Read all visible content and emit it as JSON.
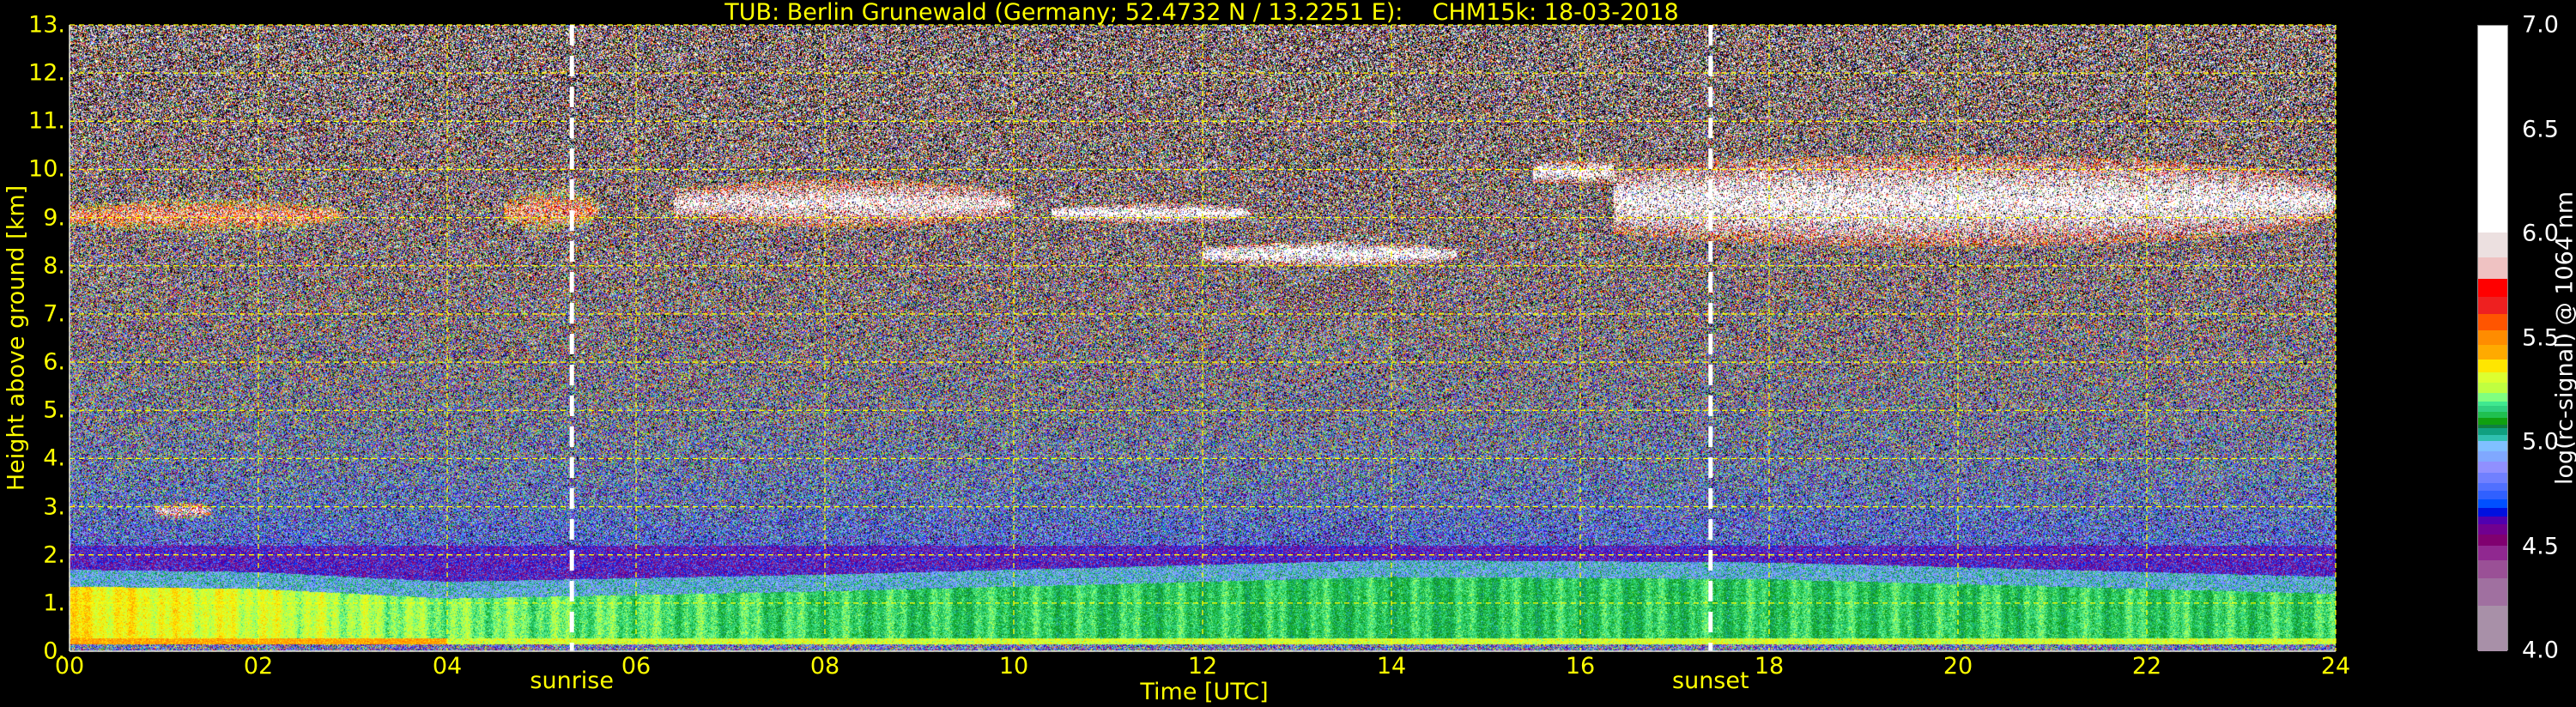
{
  "chart_data": {
    "type": "heatmap",
    "title": "TUB: Berlin Grunewald (Germany; 52.4732 N / 13.2251 E):    CHM15k: 18-03-2018",
    "xlabel": "Time [UTC]",
    "ylabel": "Height above ground [km]",
    "xlim": [
      0,
      24
    ],
    "ylim": [
      0,
      13
    ],
    "xticks": [
      "00",
      "02",
      "04",
      "06",
      "08",
      "10",
      "12",
      "14",
      "16",
      "18",
      "20",
      "22",
      "24"
    ],
    "xtick_values": [
      0,
      2,
      4,
      6,
      8,
      10,
      12,
      14,
      16,
      18,
      20,
      22,
      24
    ],
    "yticks": [
      "0.",
      "1.",
      "2.",
      "3.",
      "4.",
      "5.",
      "6.",
      "7.",
      "8.",
      "9.",
      "10.",
      "11.",
      "12.",
      "13."
    ],
    "ytick_values": [
      0,
      1,
      2,
      3,
      4,
      5,
      6,
      7,
      8,
      9,
      10,
      11,
      12,
      13
    ],
    "grid": true,
    "grid_color": "#ffff00",
    "annotations": [
      {
        "label": "sunrise",
        "time": 5.32
      },
      {
        "label": "sunset",
        "time": 17.38
      }
    ],
    "colorbar": {
      "label": "log(rc-signal) @ 1064 nm",
      "range": [
        4.0,
        7.0
      ],
      "ticks": [
        "4.0",
        "4.5",
        "5.0",
        "5.5",
        "6.0",
        "6.5",
        "7.0"
      ],
      "tick_values": [
        4.0,
        4.5,
        5.0,
        5.5,
        6.0,
        6.5,
        7.0
      ],
      "bounds": [
        4.0,
        4.22,
        4.35,
        4.44,
        4.51,
        4.56,
        4.61,
        4.65,
        4.69,
        4.73,
        4.77,
        4.81,
        4.86,
        4.91,
        4.96,
        5.01,
        5.04,
        5.07,
        5.09,
        5.12,
        5.15,
        5.18,
        5.2,
        5.24,
        5.29,
        5.34,
        5.4,
        5.47,
        5.54,
        5.62,
        5.7,
        5.79,
        5.89,
        6.01,
        6.19,
        7.0
      ],
      "colors": [
        "#a890a8",
        "#a070a0",
        "#9a5096",
        "#902890",
        "#800070",
        "#700090",
        "#5000b0",
        "#0010e0",
        "#0050ff",
        "#3060ff",
        "#5070ff",
        "#7080ff",
        "#9090ff",
        "#80a8ff",
        "#80c0ff",
        "#30c0b0",
        "#10a080",
        "#108040",
        "#10a010",
        "#20c050",
        "#30d080",
        "#40e890",
        "#80ff80",
        "#c0ff40",
        "#ddff30",
        "#ffe600",
        "#ffaa00",
        "#ff8c00",
        "#ff5500",
        "#ee2020",
        "#ff0000",
        "#efc2c2",
        "#ece0e0",
        "#ffffff",
        "#ffffff"
      ]
    },
    "boundary_layer": [
      {
        "time": 0,
        "top_km": 1.35,
        "value": 5.36
      },
      {
        "time": 2,
        "top_km": 1.3,
        "value": 5.3
      },
      {
        "time": 4,
        "top_km": 1.1,
        "value": 5.22
      },
      {
        "time": 8,
        "top_km": 1.25,
        "value": 5.16
      },
      {
        "time": 14,
        "top_km": 1.55,
        "value": 5.14
      },
      {
        "time": 18,
        "top_km": 1.5,
        "value": 5.15
      },
      {
        "time": 24,
        "top_km": 1.2,
        "value": 5.16
      }
    ],
    "cloud_features": [
      {
        "t0": 0.0,
        "t1": 2.9,
        "h0": 8.7,
        "h1": 9.4,
        "value": 5.75
      },
      {
        "t0": 0.9,
        "t1": 1.5,
        "h0": 2.75,
        "h1": 3.1,
        "value": 6.0
      },
      {
        "t0": 4.6,
        "t1": 5.6,
        "h0": 8.7,
        "h1": 9.6,
        "value": 5.7
      },
      {
        "t0": 6.4,
        "t1": 10.0,
        "h0": 8.8,
        "h1": 9.8,
        "value": 6.2
      },
      {
        "t0": 10.4,
        "t1": 12.5,
        "h0": 8.9,
        "h1": 9.3,
        "value": 6.4
      },
      {
        "t0": 12.0,
        "t1": 14.7,
        "h0": 8.0,
        "h1": 8.5,
        "value": 6.4
      },
      {
        "t0": 15.5,
        "t1": 24.0,
        "h0": 8.4,
        "h1": 10.3,
        "value": 6.3
      }
    ]
  }
}
